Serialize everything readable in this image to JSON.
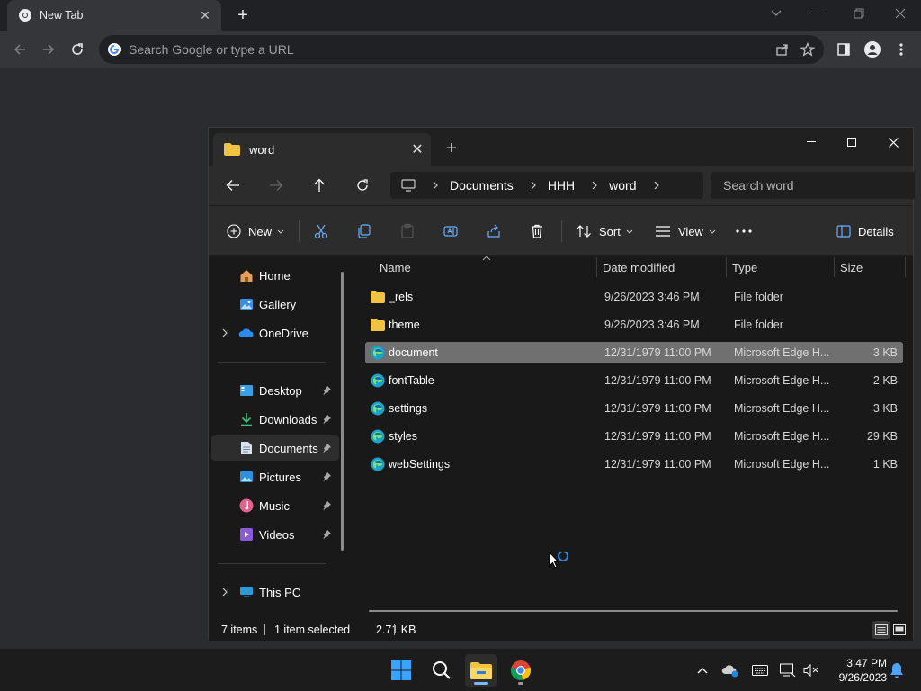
{
  "chrome": {
    "tab_title": "New Tab",
    "omnibox_placeholder": "Search Google or type a URL"
  },
  "explorer": {
    "tab_title": "word",
    "breadcrumb": [
      "Documents",
      "HHH",
      "word"
    ],
    "search_placeholder": "Search word",
    "commands": {
      "new_label": "New",
      "sort_label": "Sort",
      "view_label": "View",
      "details_label": "Details"
    },
    "nav": {
      "home": "Home",
      "gallery": "Gallery",
      "onedrive": "OneDrive",
      "desktop": "Desktop",
      "downloads": "Downloads",
      "documents": "Documents",
      "pictures": "Pictures",
      "music": "Music",
      "videos": "Videos",
      "thispc": "This PC"
    },
    "columns": {
      "name": "Name",
      "date": "Date modified",
      "type": "Type",
      "size": "Size"
    },
    "files": [
      {
        "name": "_rels",
        "date": "9/26/2023 3:46 PM",
        "type": "File folder",
        "size": "",
        "kind": "folder"
      },
      {
        "name": "theme",
        "date": "9/26/2023 3:46 PM",
        "type": "File folder",
        "size": "",
        "kind": "folder"
      },
      {
        "name": "document",
        "date": "12/31/1979 11:00 PM",
        "type": "Microsoft Edge H...",
        "size": "3 KB",
        "kind": "edge"
      },
      {
        "name": "fontTable",
        "date": "12/31/1979 11:00 PM",
        "type": "Microsoft Edge H...",
        "size": "2 KB",
        "kind": "edge"
      },
      {
        "name": "settings",
        "date": "12/31/1979 11:00 PM",
        "type": "Microsoft Edge H...",
        "size": "3 KB",
        "kind": "edge"
      },
      {
        "name": "styles",
        "date": "12/31/1979 11:00 PM",
        "type": "Microsoft Edge H...",
        "size": "29 KB",
        "kind": "edge"
      },
      {
        "name": "webSettings",
        "date": "12/31/1979 11:00 PM",
        "type": "Microsoft Edge H...",
        "size": "1 KB",
        "kind": "edge"
      }
    ],
    "status": {
      "count": "7 items",
      "selection": "1 item selected",
      "selection_size": "2.71 KB"
    }
  },
  "taskbar": {
    "time": "3:47 PM",
    "date": "9/26/2023"
  },
  "colors": {
    "accent": "#0078d4",
    "folder": "#f0c343",
    "selected_row": "#707070"
  }
}
